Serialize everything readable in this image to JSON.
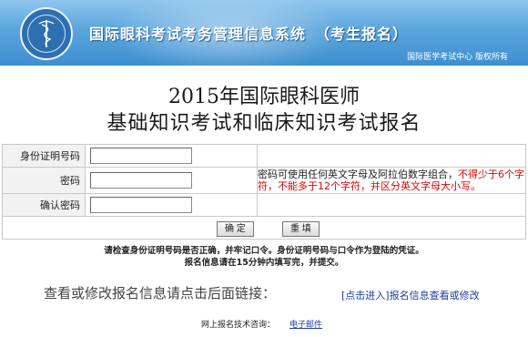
{
  "header": {
    "system_name": "国际眼科考试考务管理信息系统",
    "system_sub": "（考生报名）",
    "copyright": "国际医学考试中心  版权所有"
  },
  "title": {
    "line1": "2015年国际眼科医师",
    "line2": "基础知识考试和临床知识考试报名"
  },
  "form": {
    "id_label": "身份证明号码",
    "id_value": "",
    "password_label": "密码",
    "password_value": "",
    "confirm_label": "确认密码",
    "confirm_value": "",
    "hint_normal": "密码可使用任何英文字母及阿拉伯数字组合，",
    "hint_red_1": "不得少于6个字符，不能多于12个字符，",
    "hint_red_2": "并区分英文字母大小写。"
  },
  "buttons": {
    "confirm": "确 定",
    "reset": "重 填"
  },
  "notice": {
    "line1": "请检查身份证明号码是否正确，并牢记口令。身份证明号码与口令作为登陆的凭证。",
    "line2": "报名信息请在15分钟内填写完，并提交。"
  },
  "query": {
    "text": "查看或修改报名信息请点击后面链接：",
    "link": "[点击进入]报名信息查看或修改"
  },
  "support": {
    "label": "网上报名技术咨询：",
    "email": "电子邮件"
  }
}
